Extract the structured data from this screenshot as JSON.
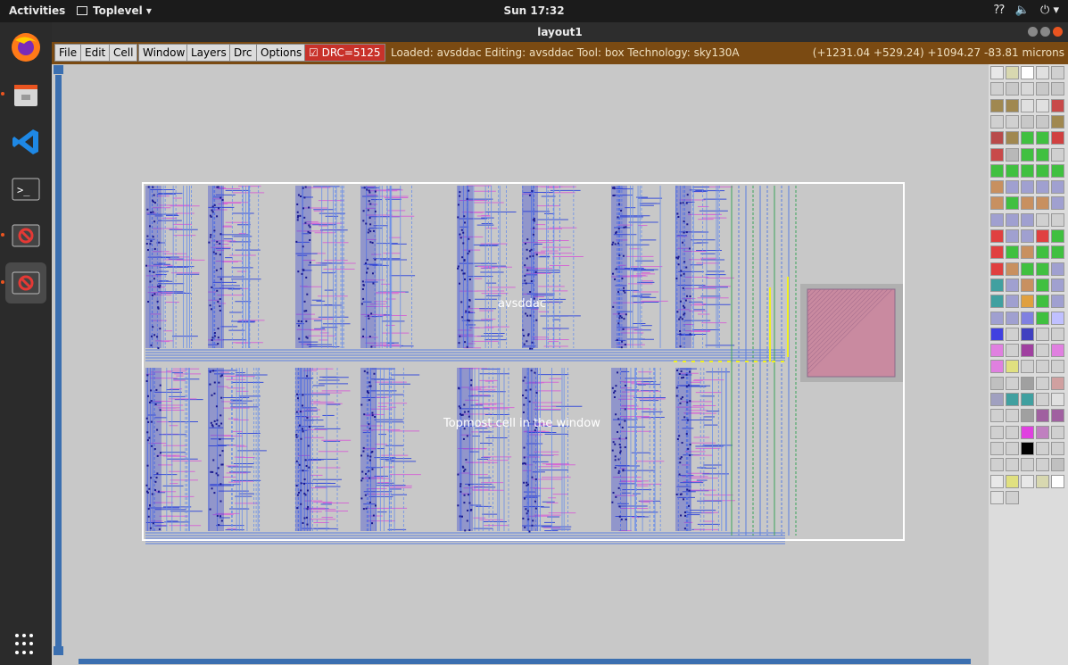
{
  "topbar": {
    "activities": "Activities",
    "app_name": "Toplevel ▾",
    "clock": "Sun 17:32"
  },
  "window": {
    "title": "layout1"
  },
  "menu": {
    "items": [
      "File",
      "Edit",
      "Cell",
      "Window",
      "Layers",
      "Drc",
      "Options"
    ],
    "drc_label": "☑ DRC=5125"
  },
  "status": {
    "text": "Loaded: avsddac Editing: avsddac Tool: box  Technology: sky130A",
    "coords": "(+1231.04 +529.24) +1094.27 -83.81 microns"
  },
  "layout": {
    "cell_name": "avsddac",
    "hint": "Topmost cell in the window"
  },
  "dock": {
    "icons": [
      "firefox-icon",
      "files-icon",
      "vscode-icon",
      "terminal-icon",
      "magic-icon",
      "magic-icon-active"
    ]
  },
  "colors": {
    "menubar": "#7a4a12",
    "canvas": "#c8c8c8",
    "accent": "#e95420"
  }
}
